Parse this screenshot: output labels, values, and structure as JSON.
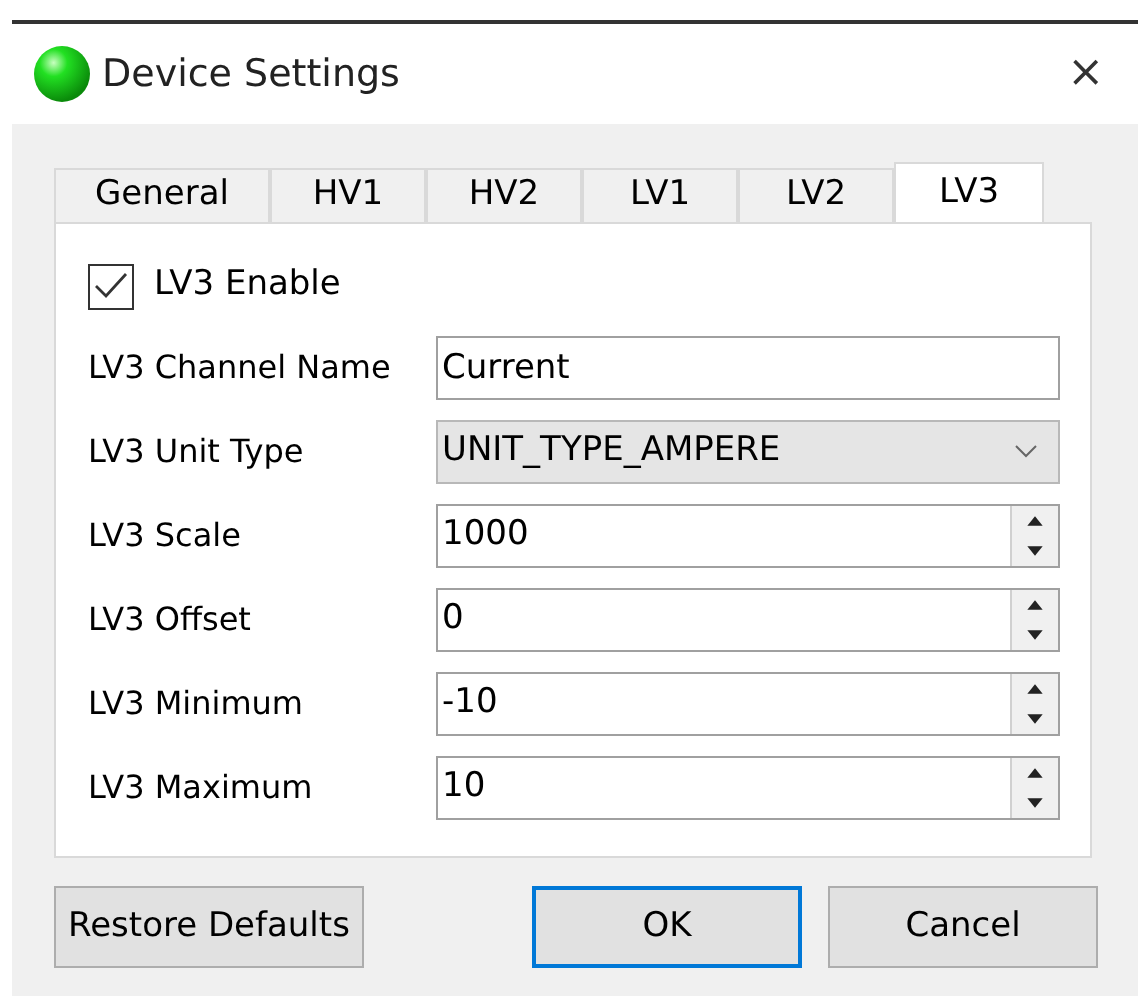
{
  "window": {
    "title": "Device Settings",
    "close": "×"
  },
  "tabs": [
    {
      "label": "General",
      "selected": false
    },
    {
      "label": "HV1",
      "selected": false
    },
    {
      "label": "HV2",
      "selected": false
    },
    {
      "label": "LV1",
      "selected": false
    },
    {
      "label": "LV2",
      "selected": false
    },
    {
      "label": "LV3",
      "selected": true
    }
  ],
  "enable": {
    "label": "LV3 Enable",
    "checked": true
  },
  "fields": [
    {
      "kind": "text",
      "label": "LV3 Channel Name",
      "value": "Current"
    },
    {
      "kind": "dropdown",
      "label": "LV3 Unit Type",
      "value": "UNIT_TYPE_AMPERE"
    },
    {
      "kind": "spin",
      "label": "LV3 Scale",
      "value": "1000"
    },
    {
      "kind": "spin",
      "label": "LV3 Offset",
      "value": "0"
    },
    {
      "kind": "spin",
      "label": "LV3 Minimum",
      "value": "-10"
    },
    {
      "kind": "spin",
      "label": "LV3 Maximum",
      "value": "10"
    }
  ],
  "buttons": [
    {
      "label": "Restore Defaults",
      "default": false
    },
    {
      "label": "OK",
      "default": true
    },
    {
      "label": "Cancel",
      "default": false
    }
  ]
}
